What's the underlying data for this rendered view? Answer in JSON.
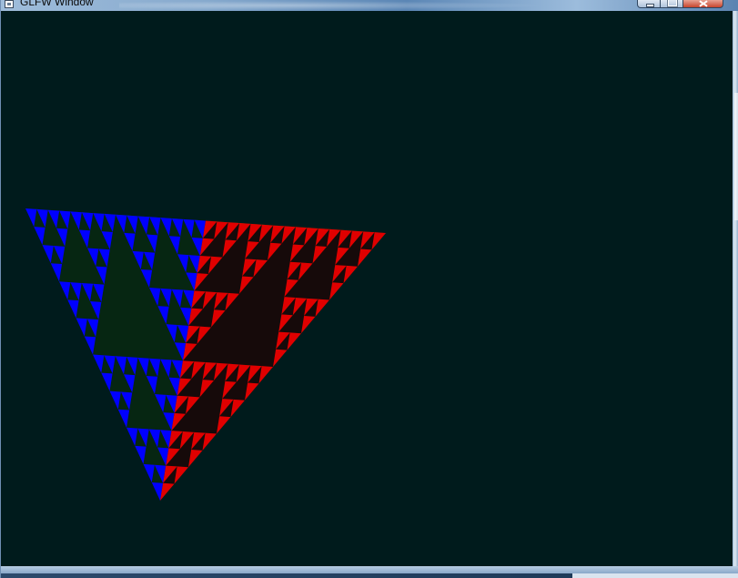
{
  "window": {
    "title": "GLFW Window",
    "icon": "app-window-icon",
    "controls": {
      "minimize": "minimize-icon",
      "maximize": "maximize-icon",
      "close": "close-icon"
    }
  },
  "scene": {
    "background_color": "#001b1c",
    "object": "sierpinski-tetrahedron",
    "face_colors": {
      "left_face": "#0000ff",
      "right_face": "#ff0000",
      "top_face": "#00cc00",
      "shadow": "#003300"
    }
  }
}
